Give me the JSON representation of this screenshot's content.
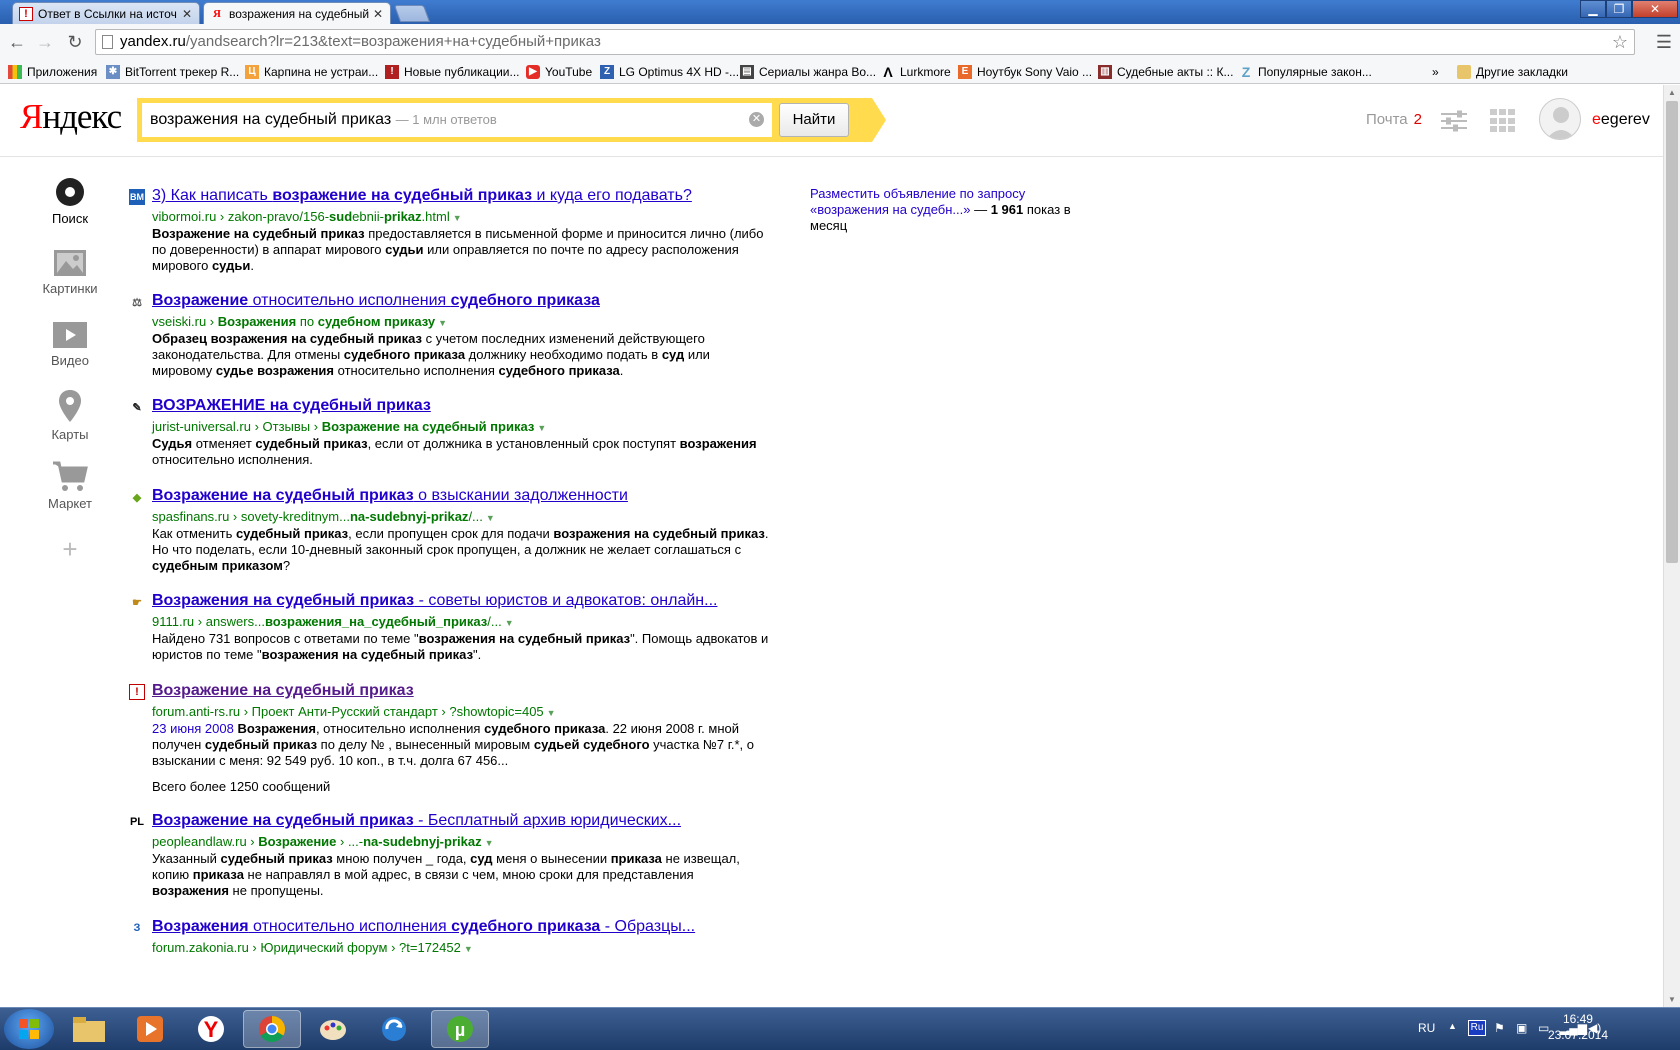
{
  "browser": {
    "tabs": [
      {
        "title": "Ответ в Ссылки на источ",
        "active": false
      },
      {
        "title": "возражения на судебный",
        "active": true
      }
    ],
    "url_host": "yandex.ru",
    "url_path": "/yandsearch?lr=213&text=возражения+на+судебный+приказ",
    "bookmarks": [
      {
        "label": "Приложения",
        "color": "#e04b3a"
      },
      {
        "label": "BitTorrent трекер R...",
        "color": "#6b8fc5"
      },
      {
        "label": "Карпина не устраи...",
        "color": "#f4a23b"
      },
      {
        "label": "Новые публикации...",
        "color": "#b02020"
      },
      {
        "label": "YouTube",
        "color": "#e52d27"
      },
      {
        "label": "LG Optimus 4X HD -...",
        "color": "#3060b0"
      },
      {
        "label": "Сериалы жанра Во...",
        "color": "#444444"
      },
      {
        "label": "Lurkmore",
        "color": "#000000"
      },
      {
        "label": "Ноутбук Sony Vaio ...",
        "color": "#e8692a"
      },
      {
        "label": "Судебные акты :: К...",
        "color": "#8a2c2c"
      },
      {
        "label": "Популярные закон...",
        "color": "#5fa2c8"
      }
    ],
    "more": "»",
    "other_bookmarks": "Другие закладки"
  },
  "header": {
    "logo_first": "Я",
    "logo_rest": "ндекс",
    "query": "возражения на судебный приказ",
    "query_hint": "— 1 млн ответов",
    "search_button": "Найти",
    "mail_label": "Почта",
    "mail_count": "2",
    "user_first": "e",
    "user_rest": "egerev"
  },
  "leftnav": [
    {
      "label": "Поиск",
      "icon": "search-icon"
    },
    {
      "label": "Картинки",
      "icon": "image-icon"
    },
    {
      "label": "Видео",
      "icon": "video-icon"
    },
    {
      "label": "Карты",
      "icon": "map-pin-icon"
    },
    {
      "label": "Маркет",
      "icon": "cart-icon"
    },
    {
      "label": "",
      "icon": "plus-icon"
    }
  ],
  "results": [
    {
      "favicon": "ВМ",
      "favicon_color": "#1e5fb8",
      "title": "3) Как написать **возражение на судебный приказ** и куда его подавать?",
      "url": "vibormoi.ru › zakon-pravo/156-**sud**ebnii-**prikaz**.html",
      "snippet": "**Возражение на судебный приказ** предоставляется в письменной форме и приносится лично (либо по доверенности) в аппарат мирового **судьи** или оправляется по почте по адресу расположения мирового **судьи**.",
      "date": "",
      "extra": "",
      "visited": false
    },
    {
      "favicon": "⚖",
      "favicon_color": "#555555",
      "title": "**Возражение** относительно исполнения **судебного приказа**",
      "url": "vseiski.ru › **Возражения** по **судебном приказу**",
      "snippet": "**Образец возражения на судебный приказ** с учетом последних изменений действующего законодательства. Для отмены **судебного приказа** должнику необходимо подать в **суд** или мировому **судье возражения** относительно исполнения **судебного приказа**.",
      "date": "",
      "extra": "",
      "visited": false
    },
    {
      "favicon": "✎",
      "favicon_color": "#222222",
      "title": "**ВОЗРАЖЕНИЕ на судебный приказ**",
      "url": "jurist-universal.ru › Отзывы › **Возражение на судебный приказ**",
      "snippet": "**Судья** отменяет **судебный приказ**, если от должника в установленный срок поступят **возражения** относительно исполнения.",
      "date": "",
      "extra": "",
      "visited": false
    },
    {
      "favicon": "◆",
      "favicon_color": "#6aa51e",
      "title": "**Возражение на судебный приказ** о взыскании задолженности",
      "url": "spasfinans.ru › sovety-kreditnym...**na-sudebnyj-prikaz**/...",
      "snippet": "Как отменить **судебный приказ**, если пропущен срок для подачи **возражения на судебный приказ**. Но что поделать, если 10-дневный законный срок пропущен, а должник не желает соглашаться с **судебным приказом**?",
      "date": "",
      "extra": "",
      "visited": false
    },
    {
      "favicon": "☛",
      "favicon_color": "#c08a1a",
      "title": "**Возражения на судебный приказ** - советы юристов и адвокатов: онлайн...",
      "url": "9111.ru › answers...**возражения_на_судебный_приказ**/...",
      "snippet": "Найдено 731 вопросов с ответами по теме \"**возражения на судебный приказ**\". Помощь адвокатов и юристов по теме \"**возражения на судебный приказ**\".",
      "date": "",
      "extra": "",
      "visited": false
    },
    {
      "favicon": "!",
      "favicon_color": "#c00000",
      "title": "**Возражение на судебный приказ**",
      "url": "forum.anti-rs.ru › Проект Анти-Русский стандарт › ?showtopic=405",
      "snippet": "**Возражения**, относительно исполнения **судебного приказа**. 22 июня 2008 г. мной получен **судебный приказ** по делу №**** , вынесенный мировым **судьей судебного** участка №7 г.*, о взыскании с меня: 92 549 руб. 10 коп., в т.ч. долга 67 456...",
      "date": "23 июня 2008",
      "extra": "Всего более 1250 сообщений",
      "visited": true
    },
    {
      "favicon": "PL",
      "favicon_color": "#000000",
      "title": "**Возражение на судебный приказ** - Бесплатный архив юридических...",
      "url": "peopleandlaw.ru › **Возражение** › ...-**na-sudebnyj-prikaz**",
      "snippet": "Указанный **судебный приказ** мною получен _ года, **суд** меня о вынесении **приказа** не извещал, копию **приказа** не направлял в мой адрес, в связи с чем, мною сроки для представления **возражения** не пропущены.",
      "date": "",
      "extra": "",
      "visited": false
    },
    {
      "favicon": "З",
      "favicon_color": "#1e5fb8",
      "title": "**Возражения** относительно исполнения **судебного приказа** - Образцы...",
      "url": "forum.zakonia.ru › Юридический форум › ?t=172452",
      "snippet": "",
      "date": "",
      "extra": "",
      "visited": false
    }
  ],
  "ad": {
    "link": "Разместить объявление по запросу «возражения на судебн...»",
    "dash": " — ",
    "count": "1 961",
    "suffix": " показ в месяц"
  },
  "taskbar": {
    "lang": "RU",
    "time": "16:49",
    "date": "23.07.2014"
  }
}
